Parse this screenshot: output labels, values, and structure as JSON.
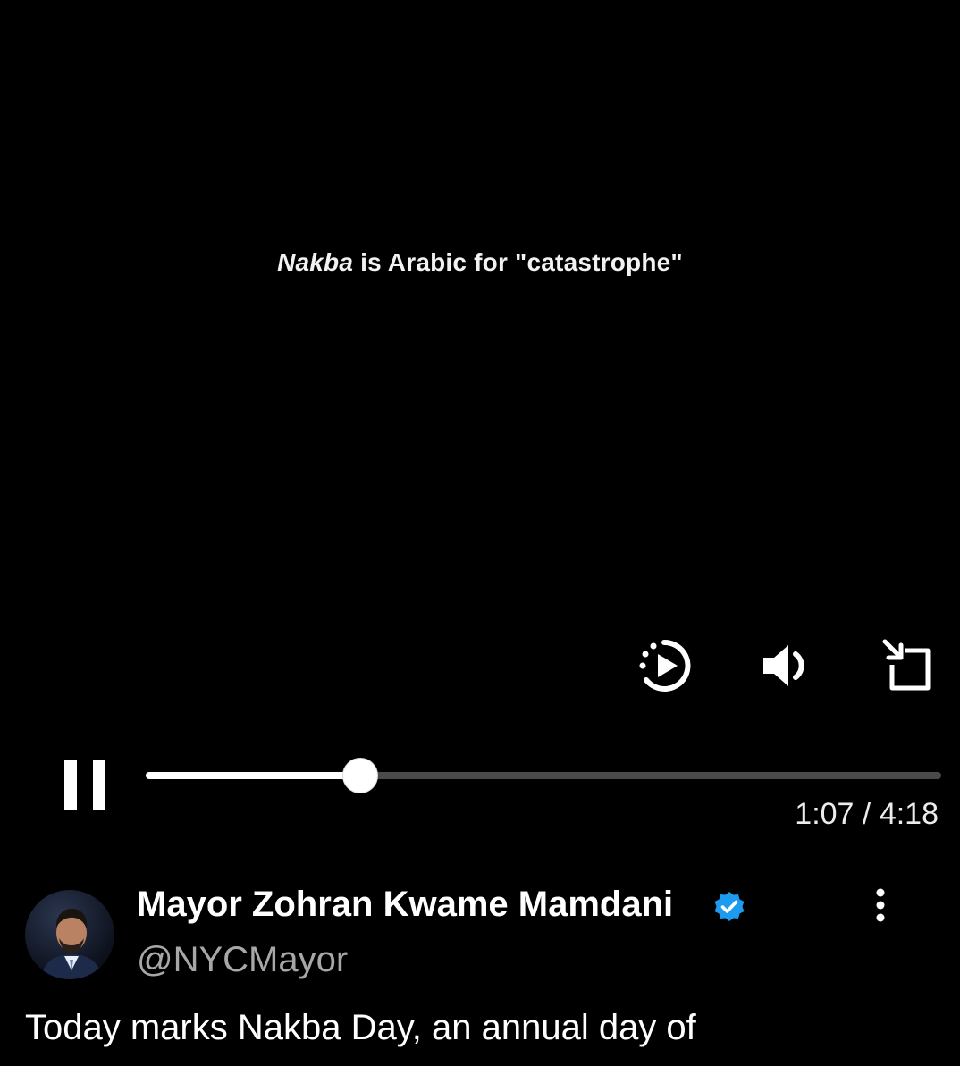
{
  "video": {
    "caption_italic": "Nakba",
    "caption_rest": " is Arabic for \"catastrophe\"",
    "progress_fraction": 0.27,
    "current_time": "1:07",
    "time_separator": " / ",
    "duration": "4:18"
  },
  "controls": {
    "icons": [
      "pause-icon",
      "autoplay-icon",
      "volume-icon",
      "exit-fullscreen-icon"
    ]
  },
  "post": {
    "author_name": "Mayor Zohran Kwame Mamdani",
    "handle": "@NYCMayor",
    "text": "Today marks Nakba Day, an annual day of",
    "verified_color": "#1d9bf0"
  }
}
